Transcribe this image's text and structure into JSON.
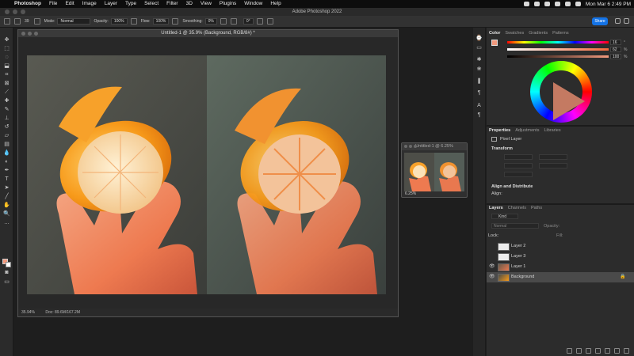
{
  "menubar": {
    "app_name": "Photoshop",
    "items": [
      "File",
      "Edit",
      "Image",
      "Layer",
      "Type",
      "Select",
      "Filter",
      "3D",
      "View",
      "Plugins",
      "Window",
      "Help"
    ],
    "clock": "Mon Mar 6  2:49 PM"
  },
  "window": {
    "title": "Adobe Photoshop 2022"
  },
  "options_bar": {
    "brush_size": "39",
    "mode_label": "Mode:",
    "mode_value": "Normal",
    "opacity_label": "Opacity:",
    "opacity_value": "100%",
    "flow_label": "Flow:",
    "flow_value": "100%",
    "smoothing_label": "Smoothing:",
    "smoothing_value": "0%",
    "angle_value": "0°",
    "share_label": "Share"
  },
  "document": {
    "title": "Untitled-1 @ 35.9% (Background, RGB/8#) *",
    "zoom": "35.94%",
    "doc_info": "Doc: 89.6M/167.2M"
  },
  "navigator": {
    "title": "Untitled-1 @ 6.25%",
    "zoom": "6.25%"
  },
  "color_panel": {
    "tabs": [
      "Color",
      "Swatches",
      "Gradients",
      "Patterns"
    ],
    "active_tab": "Color",
    "values": [
      {
        "value": "16",
        "unit": "°"
      },
      {
        "value": "62",
        "unit": "%"
      },
      {
        "value": "100",
        "unit": "%"
      }
    ],
    "foreground": "#f29a7e",
    "background": "#ffffff"
  },
  "properties_panel": {
    "tabs": [
      "Properties",
      "Adjustments",
      "Libraries"
    ],
    "active_tab": "Properties",
    "kind": "Pixel Layer",
    "transform_label": "Transform",
    "align_section": "Align and Distribute",
    "align_label": "Align:"
  },
  "layers_panel": {
    "tabs": [
      "Layers",
      "Channels",
      "Paths"
    ],
    "active_tab": "Layers",
    "filter_kind": "Kind",
    "blend_mode": "Normal",
    "opacity_label": "Opacity:",
    "lock_label": "Lock:",
    "fill_label": "Fill:",
    "layers": [
      {
        "name": "Layer 2",
        "visible": false
      },
      {
        "name": "Layer 3",
        "visible": false
      },
      {
        "name": "Layer 1",
        "visible": true
      },
      {
        "name": "Background",
        "visible": true,
        "selected": true,
        "locked": true
      }
    ]
  }
}
